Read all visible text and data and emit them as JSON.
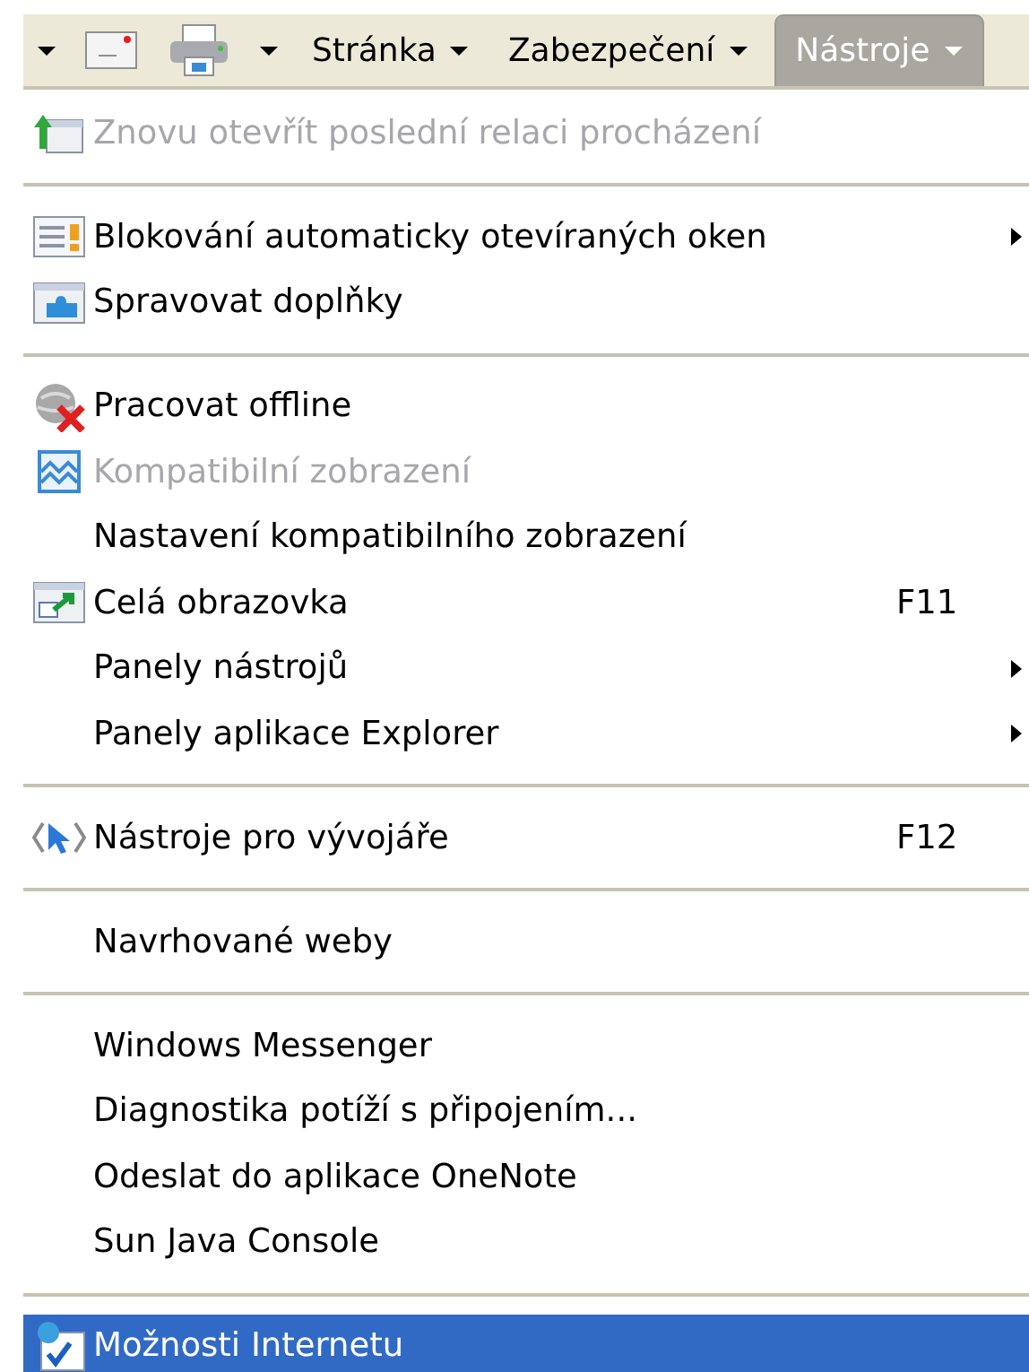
{
  "toolbar": {
    "buttons": [
      {
        "kind": "arrow"
      },
      {
        "kind": "mail"
      },
      {
        "kind": "print"
      },
      {
        "kind": "arrow"
      },
      {
        "kind": "menu",
        "label": "Stránka",
        "selected": false
      },
      {
        "kind": "menu",
        "label": "Zabezpečení",
        "selected": false
      },
      {
        "kind": "menu",
        "label": "Nástroje",
        "selected": true
      }
    ]
  },
  "menu": {
    "items": [
      {
        "kind": "item",
        "label": "Znovu otevřít poslední relaci procházení",
        "disabled": true,
        "selected": false
      },
      {
        "kind": "separator"
      },
      {
        "kind": "item",
        "label": "Blokování automaticky otevíraných oken",
        "disabled": false,
        "submenu": true,
        "selected": false
      },
      {
        "kind": "item",
        "label": "Spravovat doplňky",
        "disabled": false,
        "selected": false
      },
      {
        "kind": "separator"
      },
      {
        "kind": "item",
        "label": "Pracovat offline",
        "disabled": false,
        "selected": false
      },
      {
        "kind": "item",
        "label": "Kompatibilní zobrazení",
        "disabled": true,
        "selected": false
      },
      {
        "kind": "item",
        "label": "Nastavení kompatibilního zobrazení",
        "disabled": false,
        "selected": false
      },
      {
        "kind": "item",
        "label": "Celá obrazovka",
        "shortcut": "F11",
        "disabled": false,
        "selected": false
      },
      {
        "kind": "item",
        "label": "Panely nástrojů",
        "disabled": false,
        "submenu": true,
        "selected": false
      },
      {
        "kind": "item",
        "label": "Panely aplikace Explorer",
        "disabled": false,
        "submenu": true,
        "selected": false
      },
      {
        "kind": "separator"
      },
      {
        "kind": "item",
        "label": "Nástroje pro vývojáře",
        "shortcut": "F12",
        "disabled": false,
        "selected": false
      },
      {
        "kind": "separator"
      },
      {
        "kind": "item",
        "label": "Navrhované weby",
        "disabled": false,
        "selected": false
      },
      {
        "kind": "separator"
      },
      {
        "kind": "item",
        "label": "Windows Messenger",
        "disabled": false,
        "selected": false
      },
      {
        "kind": "item",
        "label": "Diagnostika potíží s připojením...",
        "disabled": false,
        "selected": false
      },
      {
        "kind": "item",
        "label": "Odeslat do aplikace OneNote",
        "disabled": false,
        "selected": false
      },
      {
        "kind": "item",
        "label": "Sun Java Console",
        "disabled": false,
        "selected": false
      },
      {
        "kind": "separator"
      },
      {
        "kind": "item",
        "label": "Možnosti Internetu",
        "disabled": false,
        "selected": true
      }
    ]
  }
}
